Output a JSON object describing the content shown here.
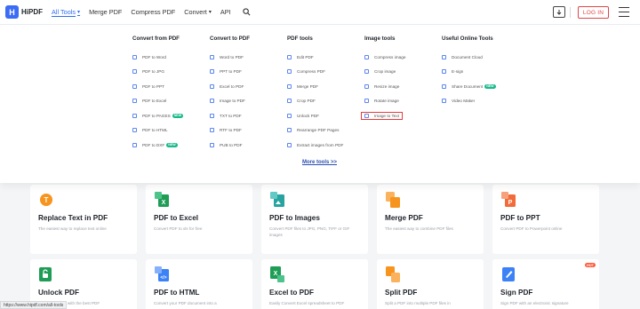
{
  "header": {
    "logo_text": "HiPDF",
    "nav": [
      "All Tools",
      "Merge PDF",
      "Compress PDF",
      "Convert",
      "API"
    ],
    "login_label": "LOG IN"
  },
  "dropdown": {
    "columns": [
      {
        "title": "Convert from PDF",
        "items": [
          "PDF to Word",
          "PDF to JPG",
          "PDF to PPT",
          "PDF to Excel",
          "PDF to PAGES",
          "PDF to HTML",
          "PDF to DXF"
        ]
      },
      {
        "title": "Convert to PDF",
        "items": [
          "Word to PDF",
          "PPT to PDF",
          "Excel to PDF",
          "Image to PDF",
          "TXT to PDF",
          "RTF to PDF",
          "PUB to PDF"
        ]
      },
      {
        "title": "PDF tools",
        "items": [
          "Edit PDF",
          "Compress PDF",
          "Merge PDF",
          "Crop PDF",
          "Unlock PDF",
          "Rearrange PDF Pages",
          "Extract images from PDF"
        ]
      },
      {
        "title": "Image tools",
        "items": [
          "Compress image",
          "Crop image",
          "Resize image",
          "Rotate image",
          "Image to Text"
        ]
      },
      {
        "title": "Useful Online Tools",
        "items": [
          "Document Cloud",
          "E-sign",
          "Share Document",
          "Video Maker"
        ]
      }
    ],
    "new_badge": "NEW",
    "more_tools": "More tools >>"
  },
  "cards": [
    {
      "title": "Replace Text in PDF",
      "desc": "The easiest way to replace text online",
      "icon": "replace-text-icon",
      "color": "#f7941d"
    },
    {
      "title": "PDF to Excel",
      "desc": "Convert PDF to xls for free",
      "icon": "excel-icon",
      "color": "#1f9d55"
    },
    {
      "title": "PDF to Images",
      "desc": "Convert PDF files to JPG, PNG, TIFF or GIF images",
      "icon": "images-icon",
      "color": "#27a3a0"
    },
    {
      "title": "Merge PDF",
      "desc": "The easiest way to combine PDF files",
      "icon": "merge-icon",
      "color": "#f7941d"
    },
    {
      "title": "PDF to PPT",
      "desc": "Convert PDF to Powerpoint online",
      "icon": "ppt-icon",
      "color": "#f26b3a"
    },
    {
      "title": "Unlock PDF",
      "desc": "Unlock PDF file with the best PDF",
      "icon": "unlock-icon",
      "color": "#1f9d55"
    },
    {
      "title": "PDF to HTML",
      "desc": "Convert your PDF document into a",
      "icon": "html-icon",
      "color": "#3b82f6"
    },
    {
      "title": "Excel to PDF",
      "desc": "Easily Convert Excel spreadsheet to PDF",
      "icon": "excel-to-pdf-icon",
      "color": "#1f9d55"
    },
    {
      "title": "Split PDF",
      "desc": "Split a PDF into multiple PDF files in",
      "icon": "split-icon",
      "color": "#f7941d"
    },
    {
      "title": "Sign PDF",
      "desc": "Sign PDF with an electronic signature",
      "icon": "sign-icon",
      "color": "#3b82f6"
    }
  ],
  "hot_badge": "HOT",
  "status_url": "https://www.hipdf.com/all-tools"
}
